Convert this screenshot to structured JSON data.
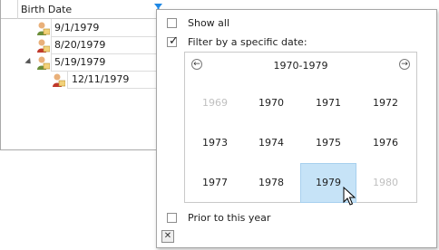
{
  "grid": {
    "column_header": "Birth Date",
    "rows": [
      {
        "value": "9/1/1979"
      },
      {
        "value": "8/20/1979"
      },
      {
        "value": "5/19/1979"
      },
      {
        "value": "12/11/1979"
      }
    ]
  },
  "filter_popup": {
    "show_all_label": "Show all",
    "specific_date_label": "Filter by a specific date:",
    "calendar": {
      "title": "1970-1979",
      "prev_glyph": "←",
      "next_glyph": "→",
      "years": [
        "1969",
        "1970",
        "1971",
        "1972",
        "1973",
        "1974",
        "1975",
        "1976",
        "1977",
        "1978",
        "1979",
        "1980"
      ],
      "selected_year": "1979"
    },
    "prior_label": "Prior to this year",
    "close_glyph": "✕"
  },
  "colors": {
    "selection_fill": "#c6e3f7",
    "filter_icon": "#1e88e5"
  }
}
